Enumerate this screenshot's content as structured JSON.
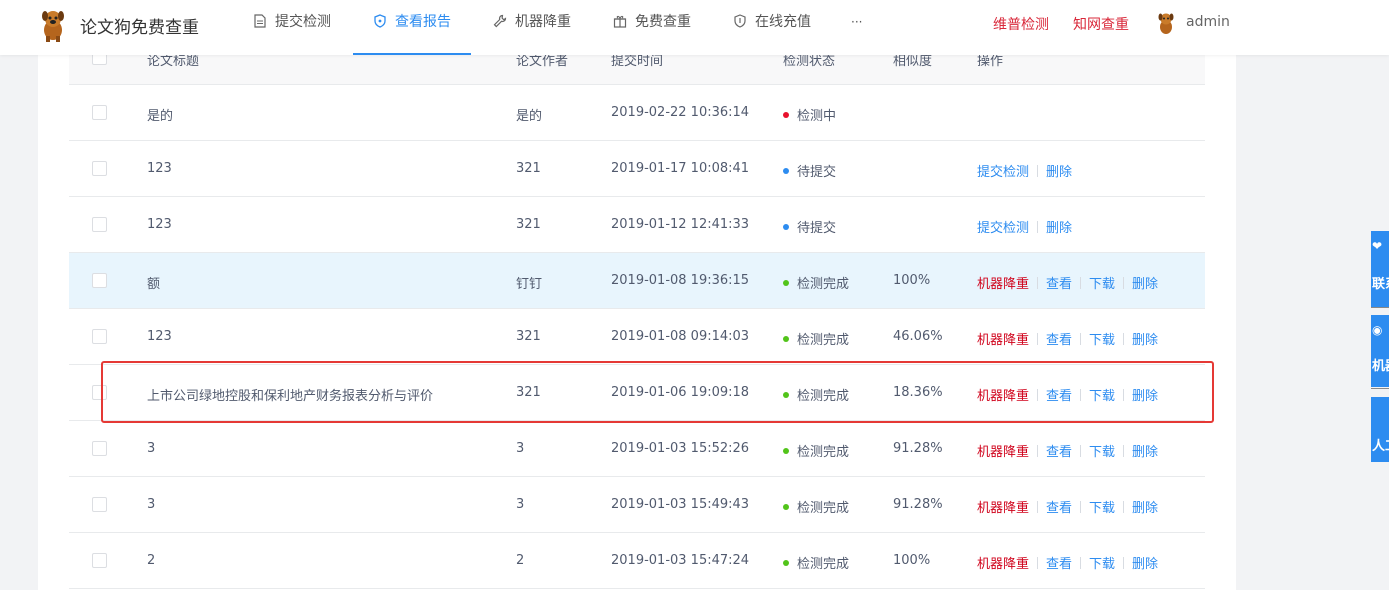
{
  "nav": {
    "brand": "论文狗免费查重",
    "items": [
      {
        "label": "提交检测",
        "icon": "document-icon"
      },
      {
        "label": "查看报告",
        "icon": "shield-icon",
        "active": true
      },
      {
        "label": "机器降重",
        "icon": "wrench-icon"
      },
      {
        "label": "免费查重",
        "icon": "gift-icon"
      },
      {
        "label": "在线充值",
        "icon": "shield-check-icon"
      }
    ],
    "more": "···",
    "links": [
      "维普检测",
      "知网查重"
    ],
    "user": "admin"
  },
  "table": {
    "headers": {
      "title": "论文标题",
      "author": "论文作者",
      "time": "提交时间",
      "status": "检测状态",
      "similarity": "相似度",
      "actions": "操作"
    },
    "rows": [
      {
        "title": "是的",
        "author": "是的",
        "time": "2019-02-22 10:36:14",
        "status": "检测中",
        "status_color": "#e8112d",
        "similarity": "",
        "actions": []
      },
      {
        "title": "123",
        "author": "321",
        "time": "2019-01-17 10:08:41",
        "status": "待提交",
        "status_color": "#2d8cf0",
        "similarity": "",
        "actions": [
          "提交检测",
          "删除"
        ]
      },
      {
        "title": "123",
        "author": "321",
        "time": "2019-01-12 12:41:33",
        "status": "待提交",
        "status_color": "#2d8cf0",
        "similarity": "",
        "actions": [
          "提交检测",
          "删除"
        ]
      },
      {
        "title": "额",
        "author": "钉钉",
        "time": "2019-01-08 19:36:15",
        "status": "检测完成",
        "status_color": "#52c41a",
        "similarity": "100%",
        "actions": [
          "机器降重",
          "查看",
          "下载",
          "删除"
        ],
        "highlight": true
      },
      {
        "title": "123",
        "author": "321",
        "time": "2019-01-08 09:14:03",
        "status": "检测完成",
        "status_color": "#52c41a",
        "similarity": "46.06%",
        "actions": [
          "机器降重",
          "查看",
          "下载",
          "删除"
        ]
      },
      {
        "title": "上市公司绿地控股和保利地产财务报表分析与评价",
        "author": "321",
        "time": "2019-01-06 19:09:18",
        "status": "检测完成",
        "status_color": "#52c41a",
        "similarity": "18.36%",
        "actions": [
          "机器降重",
          "查看",
          "下载",
          "删除"
        ]
      },
      {
        "title": "3",
        "author": "3",
        "time": "2019-01-03 15:52:26",
        "status": "检测完成",
        "status_color": "#52c41a",
        "similarity": "91.28%",
        "actions": [
          "机器降重",
          "查看",
          "下载",
          "删除"
        ]
      },
      {
        "title": "3",
        "author": "3",
        "time": "2019-01-03 15:49:43",
        "status": "检测完成",
        "status_color": "#52c41a",
        "similarity": "91.28%",
        "actions": [
          "机器降重",
          "查看",
          "下载",
          "删除"
        ]
      },
      {
        "title": "2",
        "author": "2",
        "time": "2019-01-03 15:47:24",
        "status": "检测完成",
        "status_color": "#52c41a",
        "similarity": "100%",
        "actions": [
          "机器降重",
          "查看",
          "下载",
          "删除"
        ]
      }
    ]
  },
  "side_widgets": [
    "联系",
    "机器",
    "人工"
  ],
  "colors": {
    "accent": "#2d8cf0",
    "danger": "#d0021b",
    "success": "#52c41a",
    "highlight_row": "#e8f5fd",
    "annotation_box": "#e53935"
  }
}
